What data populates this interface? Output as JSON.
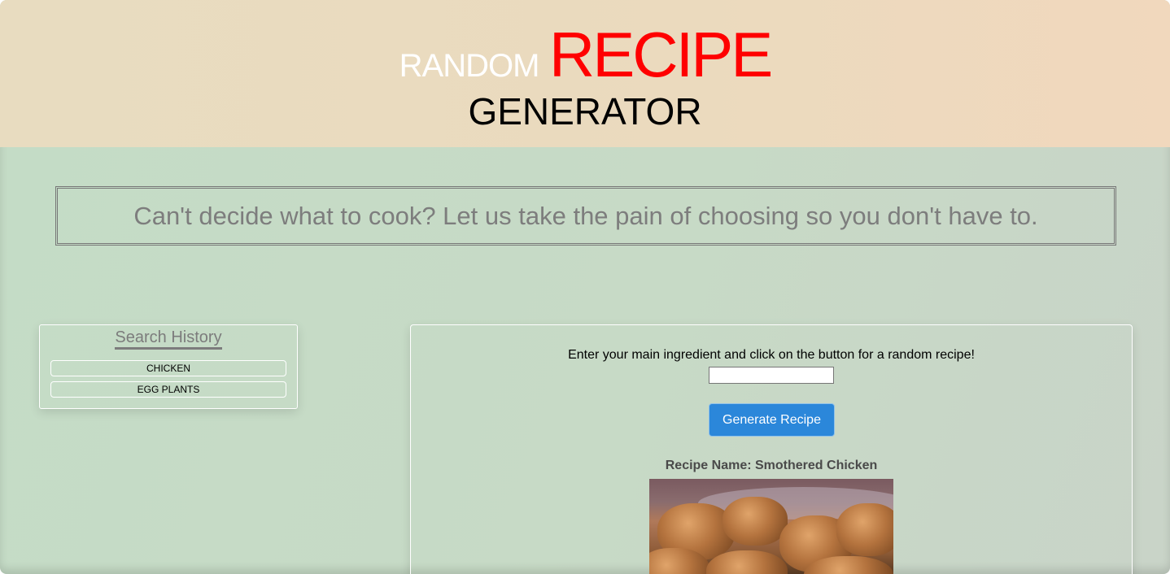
{
  "header": {
    "title_random": "RANDOM",
    "title_recipe": "RECIPE",
    "title_generator": "GENERATOR"
  },
  "tagline": "Can't decide what to cook? Let us take the pain of choosing so you don't have to.",
  "search_history": {
    "title": "Search History",
    "items": [
      {
        "label": "CHICKEN"
      },
      {
        "label": "EGG PLANTS"
      }
    ]
  },
  "main": {
    "instruction": "Enter your main ingredient and click on the button for a random recipe!",
    "input_value": "",
    "generate_label": "Generate Recipe",
    "recipe_name": "Recipe Name: Smothered Chicken"
  },
  "colors": {
    "accent_red": "#ff0000",
    "button_blue": "#2b87da",
    "header_bg": "#ebdabe",
    "body_bg": "#c4dcc6"
  }
}
